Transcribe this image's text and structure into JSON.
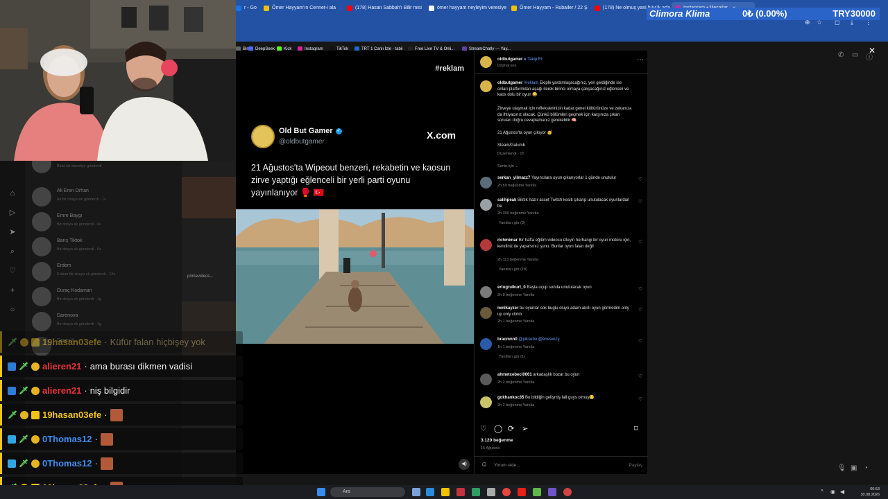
{
  "browser": {
    "tabs": [
      {
        "label": "r - Go",
        "color": "#1a73e8",
        "active": false
      },
      {
        "label": "Ömer Hayyam'ın Cennet-i ala",
        "color": "#f2c200",
        "active": false
      },
      {
        "label": "(178) Hasan Sabbah'ı Bilir misi",
        "color": "#ff0000",
        "active": false
      },
      {
        "label": "ömer hayyam neyleyim veresiye",
        "color": "#ffffff",
        "active": false
      },
      {
        "label": "Ömer Hayyam - Rubailer / 22 Ş",
        "color": "#f2c200",
        "active": false
      },
      {
        "label": "(178) Ne olmuş yani büyük ada",
        "color": "#ff0000",
        "active": false
      },
      {
        "label": "Instagram • Mesajlar",
        "color": "#d6249f",
        "active": true
      }
    ],
    "bookmarks": [
      {
        "label": "Bin",
        "color": "#666"
      },
      {
        "label": "DeepSeek",
        "color": "#4d6bfe"
      },
      {
        "label": "Kick",
        "color": "#53fc18"
      },
      {
        "label": "Instagram",
        "color": "#d6249f"
      },
      {
        "label": "TikTok",
        "color": "#111111"
      },
      {
        "label": "TRT 1 Canlı İzle - tabii",
        "color": "#1b6ac9"
      },
      {
        "label": "Free Live TV & Onli...",
        "color": "#222222"
      },
      {
        "label": "StreamChatly — Yay...",
        "color": "#6441a5"
      }
    ]
  },
  "ticker": {
    "name": "Climora Klima",
    "delta": "0₺ (0.00%)",
    "price": "TRY30000"
  },
  "dm_list": [
    {
      "name": "",
      "sub": "Birisi bir davetiye gönderdi"
    },
    {
      "name": "Ali Eren Orhan",
      "sub": "Ali bir dosya ek gönderdi · 1s"
    },
    {
      "name": "Emre Baygı",
      "sub": "Bir dosya ek gönderdi · 6s"
    },
    {
      "name": "Barış Tiktok",
      "sub": "Bir dosya ek gönderdi · 6s"
    },
    {
      "name": "Erdem",
      "sub": "Erdem bir dosya ek gönderdi · 12s"
    },
    {
      "name": "Duraç Kodaman",
      "sub": "Bir dosya ek gönderdi · 1g"
    },
    {
      "name": "Darenova",
      "sub": "Bir dosya ek gönderdi · 1g"
    },
    {
      "name": "Daren K.",
      "sub": ""
    }
  ],
  "post": {
    "tag": "#reklam",
    "card_name": "Old But Gamer",
    "card_handle": "@oldbutgamer",
    "card_brand": "X.com",
    "card_text": "21 Ağustos'ta Wipeout benzeri, rekabetin ve kaosun zirve yaptığı eğlenceli bir yerli parti oyunu yayınlanıyor 🥊 🇹🇷"
  },
  "panel": {
    "header_user": "oldbutgamer",
    "header_follow": "Takip Et",
    "header_sub": "Orijinal ses",
    "caption_user": "oldbutgamer",
    "caption_tag": "#reklam",
    "caption_p1": "Ekiple yardımlaşacağınız, yeri geldiğinde ise onları platformdan aşağı iterek birinci olmaya çalışacağınız eğlenceli ve kaos dolu bir oyun 😄",
    "caption_p2": "Zirveye ulaşmak için reflekslerinizin kadar genel kültürünüze ve zekanıza da ihtiyacınız olacak. Çünkü bölümleri geçmek için karşınıza çıkan soruları doğru cevaplamanız gerekebilir 🧠",
    "caption_p3": "21 Ağustos'ta oyun çıkıyor 🥳",
    "caption_p4": "Steam/Galumb",
    "caption_meta": "Düzenlendi · 1h",
    "sort": "Senin için ⌄",
    "comments": [
      {
        "user": "serkan_yilmazz7",
        "text": "Yayıncılara oyun çıkarıyorlar 1 günde unutulur",
        "meta": "2h   59 beğenme   Yanıtla",
        "replies": ""
      },
      {
        "user": "salihpeak",
        "text": "Biktık hazır asset Twitch kesiti çıkarıp unutulacak oyunlardan be",
        "meta": "2h   309 beğenme   Yanıtla",
        "replies": "Yanıtları gör (3)"
      },
      {
        "user": "richmimar",
        "text": "Bir hafta eğitim videosu izleyin herhangi bir oyun motoru için, kendiniz de yaparsınız şunu. Bunlar oyun falan değil",
        "meta": "2h   113 beğenme   Yanıtla",
        "replies": "Yanıtları gör (18)"
      },
      {
        "user": "ertugrulkurt_0",
        "text": "Başta uçup sonda unutulacak oyun",
        "meta": "2h   9 beğenme   Yanıtla",
        "replies": ""
      },
      {
        "user": "iwnlkayzer",
        "text": "bu oyunlar cok buglu oluyo adam akıllı oyun görmedim only up only climb",
        "meta": "2h   1 beğenme   Yanıtla",
        "replies": ""
      },
      {
        "user": "bracmnn0",
        "mention": "@piksebu @eneswizy",
        "text": "",
        "meta": "1h   1 beğenme   Yanıtla",
        "replies": "Yanıtları gör (1)"
      },
      {
        "user": "ahmetcebeci0061",
        "text": "arkadaşlık bozar bu oyun",
        "meta": "2h   2 beğenme   Yanıtla",
        "replies": ""
      },
      {
        "user": "gokhankoc35",
        "text": "Bu bildiğin gelişmiş fall guys olmuş🥲",
        "meta": "2h   2 beğenme   Yanıtla",
        "replies": ""
      }
    ],
    "likes": "3.120 beğenme",
    "date": "15 Ağustos",
    "comment_placeholder": "Yorum ekle...",
    "share": "Paylaş"
  },
  "chat": [
    {
      "user": "19hasan03efe",
      "msg": "Küfür falan hiçbişey yok",
      "color": "#f0c419",
      "faded": true,
      "emote": false
    },
    {
      "user": "alieren21",
      "msg": "ama burası dikmen vadisi",
      "color": "#e8313b",
      "faded": false,
      "emote": false
    },
    {
      "user": "alieren21",
      "msg": "niş bilgidir",
      "color": "#e8313b",
      "faded": false,
      "emote": false
    },
    {
      "user": "19hasan03efe",
      "msg": "",
      "color": "#f0c419",
      "faded": false,
      "emote": true
    },
    {
      "user": "0Thomas12",
      "msg": "",
      "color": "#3a8bf0",
      "faded": false,
      "emote": true
    },
    {
      "user": "0Thomas12",
      "msg": "",
      "color": "#3a8bf0",
      "faded": false,
      "emote": true
    },
    {
      "user": "19hasan03efe",
      "msg": "",
      "color": "#f0c419",
      "faded": false,
      "emote": true
    }
  ],
  "taskbar": {
    "search": "Ara",
    "time": "00:53",
    "date": "30.08.2026"
  }
}
